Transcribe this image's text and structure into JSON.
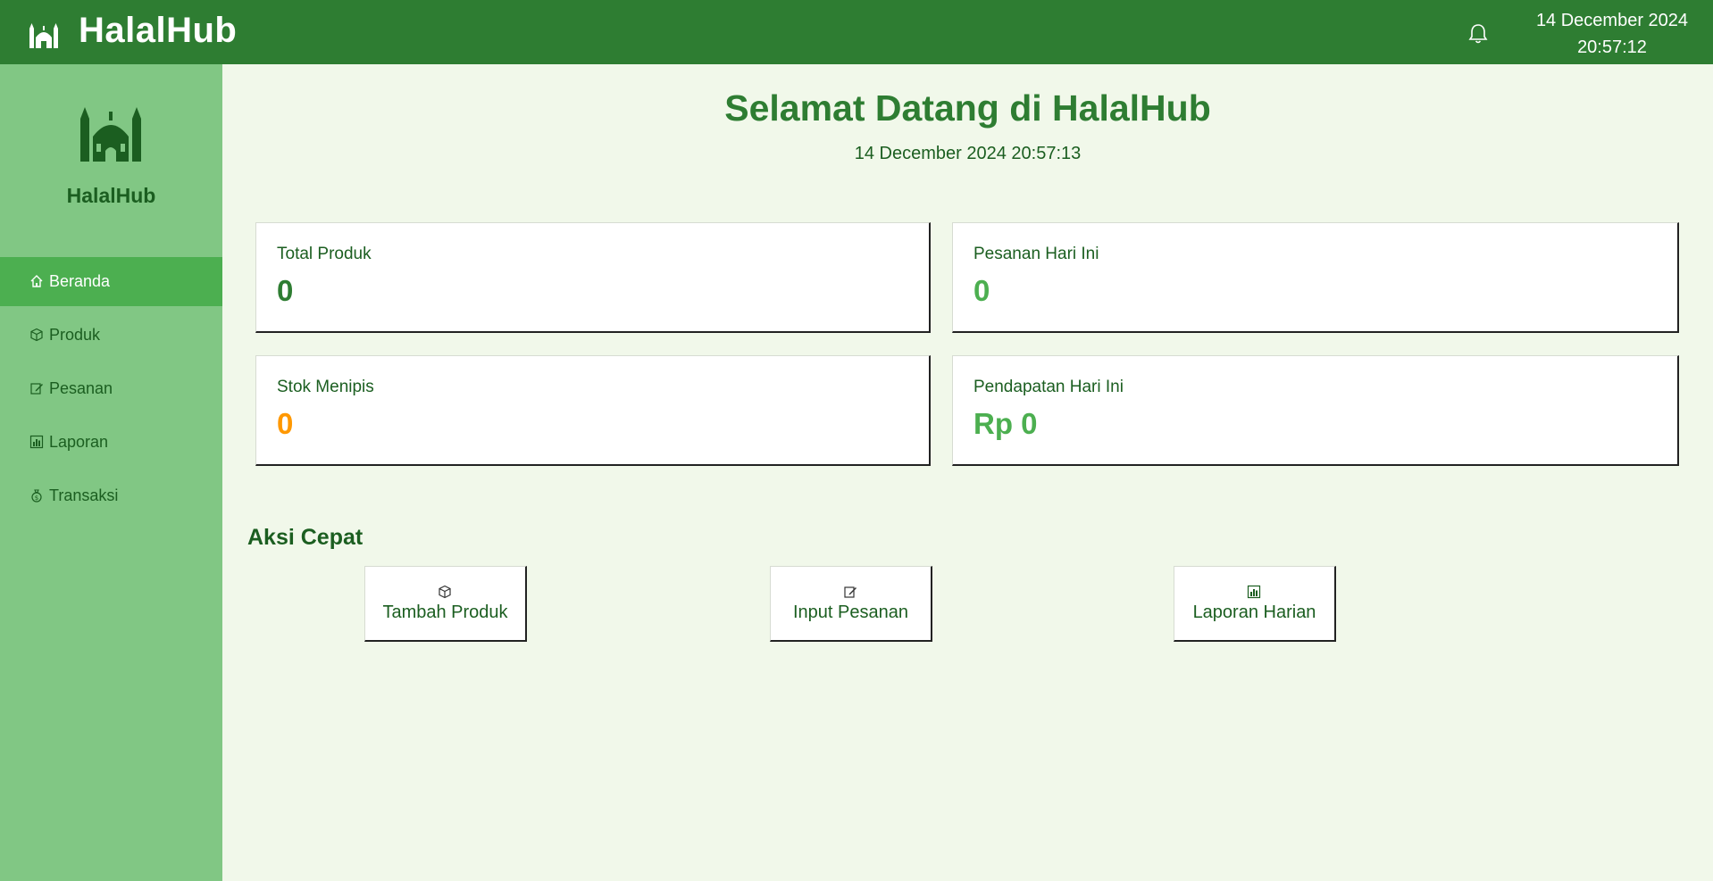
{
  "header": {
    "title": "HalalHub",
    "logo_icon": "mosque-icon",
    "notification_icon": "bell-icon",
    "date": "14 December 2024",
    "time": "20:57:12"
  },
  "sidebar": {
    "brand_name": "HalalHub",
    "brand_icon": "mosque-icon",
    "items": [
      {
        "label": "Beranda",
        "icon": "home-icon",
        "active": true
      },
      {
        "label": "Produk",
        "icon": "package-icon",
        "active": false
      },
      {
        "label": "Pesanan",
        "icon": "edit-icon",
        "active": false
      },
      {
        "label": "Laporan",
        "icon": "bar-chart-icon",
        "active": false
      },
      {
        "label": "Transaksi",
        "icon": "money-bag-icon",
        "active": false
      }
    ]
  },
  "main": {
    "welcome_title": "Selamat Datang di HalalHub",
    "welcome_datetime": "14 December 2024 20:57:13",
    "stats": [
      {
        "label": "Total Produk",
        "value": "0",
        "color": "#2e7d32"
      },
      {
        "label": "Pesanan Hari Ini",
        "value": "0",
        "color": "#4caf50"
      },
      {
        "label": "Stok Menipis",
        "value": "0",
        "color": "#ff9800"
      },
      {
        "label": "Pendapatan Hari Ini",
        "value": "Rp 0",
        "color": "#4caf50"
      }
    ],
    "quick_actions_title": "Aksi Cepat",
    "quick_actions": [
      {
        "label": "Tambah Produk",
        "icon": "package-icon"
      },
      {
        "label": "Input Pesanan",
        "icon": "edit-icon"
      },
      {
        "label": "Laporan Harian",
        "icon": "bar-chart-icon"
      }
    ]
  },
  "colors": {
    "header_bg": "#2e7d32",
    "sidebar_bg": "#81c784",
    "active_item_bg": "#4caf50",
    "page_bg": "#f1f8ea",
    "text_dark_green": "#1b5e20"
  }
}
